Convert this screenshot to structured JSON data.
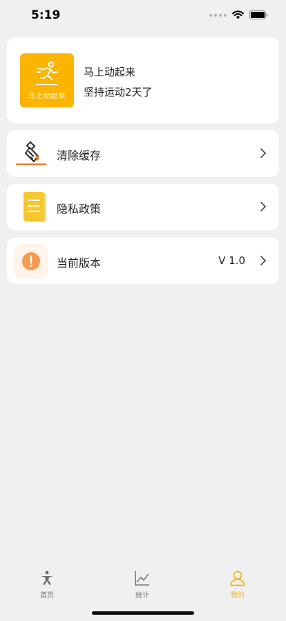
{
  "status_bar": {
    "time": "5:19"
  },
  "profile": {
    "logo_text": "马上动起来",
    "name": "马上动起来",
    "subtitle": "坚持运动2天了"
  },
  "menu": [
    {
      "label": "清除缓存",
      "value": "",
      "icon": "broom-icon"
    },
    {
      "label": "隐私政策",
      "value": "",
      "icon": "document-icon"
    },
    {
      "label": "当前版本",
      "value": "V 1.0",
      "icon": "exclamation-icon"
    }
  ],
  "tabs": [
    {
      "label": "首页",
      "icon": "exercise-icon",
      "active": false
    },
    {
      "label": "统计",
      "icon": "line-chart-icon",
      "active": false
    },
    {
      "label": "我的",
      "icon": "user-icon",
      "active": true
    }
  ],
  "colors": {
    "accent": "#fbb400",
    "background": "#f0f0f0",
    "card": "#ffffff",
    "broom_orange": "#f07b2c",
    "alert_orange": "#f59a4f"
  }
}
